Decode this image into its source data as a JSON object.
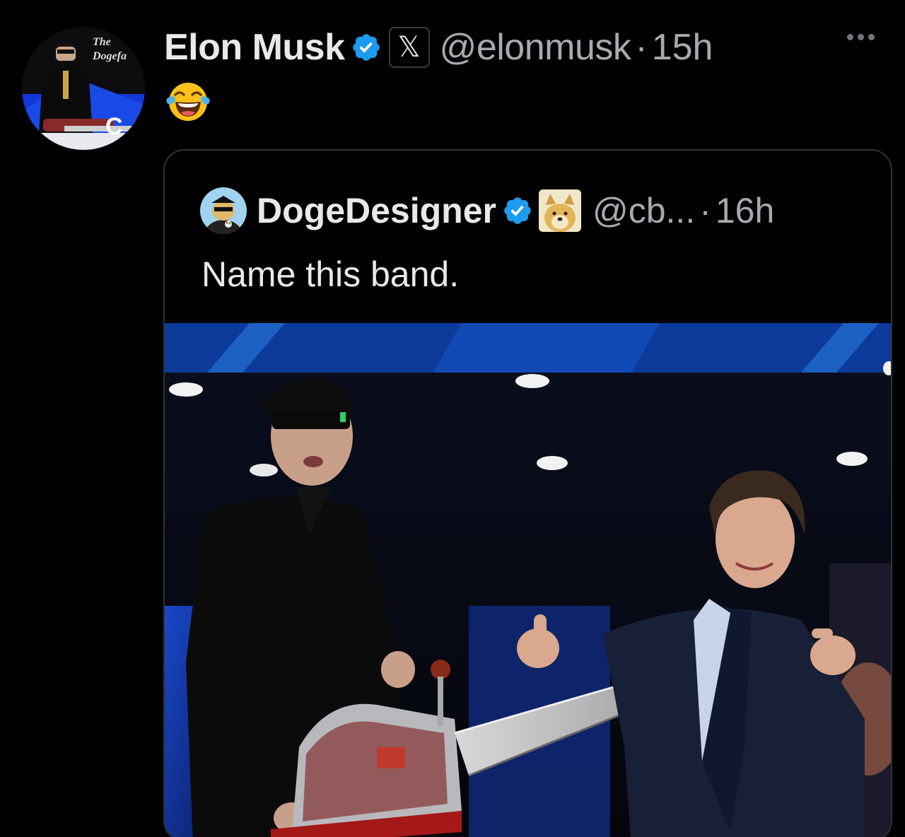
{
  "tweet": {
    "author": {
      "display_name": "Elon Musk",
      "handle": "@elonmusk",
      "time": "15h",
      "separator": "·",
      "avatar_text": [
        "The",
        "Dogefa"
      ],
      "verified_icon": "verified-badge-icon",
      "affiliation_icon": "x-logo-icon",
      "affiliation_glyph": "𝕏"
    },
    "body_emoji": "😂",
    "more_icon": "more-options-icon",
    "quote": {
      "display_name": "DogeDesigner",
      "handle": "@cb...",
      "time": "16h",
      "separator": "·",
      "text": "Name this band.",
      "verified_icon": "verified-badge-icon",
      "affiliation_icon": "doge-badge-icon"
    }
  },
  "colors": {
    "background": "#000000",
    "text_primary": "#e7e9ea",
    "text_secondary": "#a6abb0",
    "verified_blue": "#1d9bf0",
    "border": "#2f3336"
  }
}
